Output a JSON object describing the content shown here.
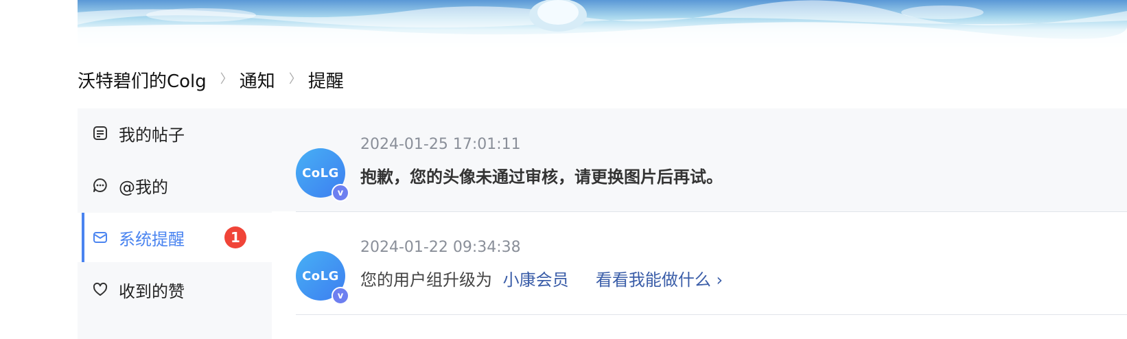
{
  "breadcrumb": {
    "items": [
      "沃特碧们的Colg",
      "通知",
      "提醒"
    ],
    "separator": "〉"
  },
  "sidebar": {
    "items": [
      {
        "label": "我的帖子",
        "icon": "post-icon",
        "active": false
      },
      {
        "label": "@我的",
        "icon": "mention-icon",
        "active": false
      },
      {
        "label": "系统提醒",
        "icon": "mail-icon",
        "active": true,
        "badge": "1"
      },
      {
        "label": "收到的赞",
        "icon": "heart-icon",
        "active": false
      }
    ]
  },
  "notices": [
    {
      "time": "2024-01-25 17:01:11",
      "message": "抱歉，您的头像未通过审核，请更换图片后再试。",
      "avatar_text": "CoLG",
      "verified_mark": "v"
    },
    {
      "time": "2024-01-22 09:34:38",
      "message_prefix": "您的用户组升级为",
      "group_link": "小康会员",
      "action_link": "看看我能做什么 ›",
      "avatar_text": "CoLG",
      "verified_mark": "v"
    }
  ],
  "colors": {
    "accent": "#4a84f0",
    "badge": "#f04438",
    "link": "#3a5da8",
    "sidebar_bg": "#f7f8fa"
  }
}
